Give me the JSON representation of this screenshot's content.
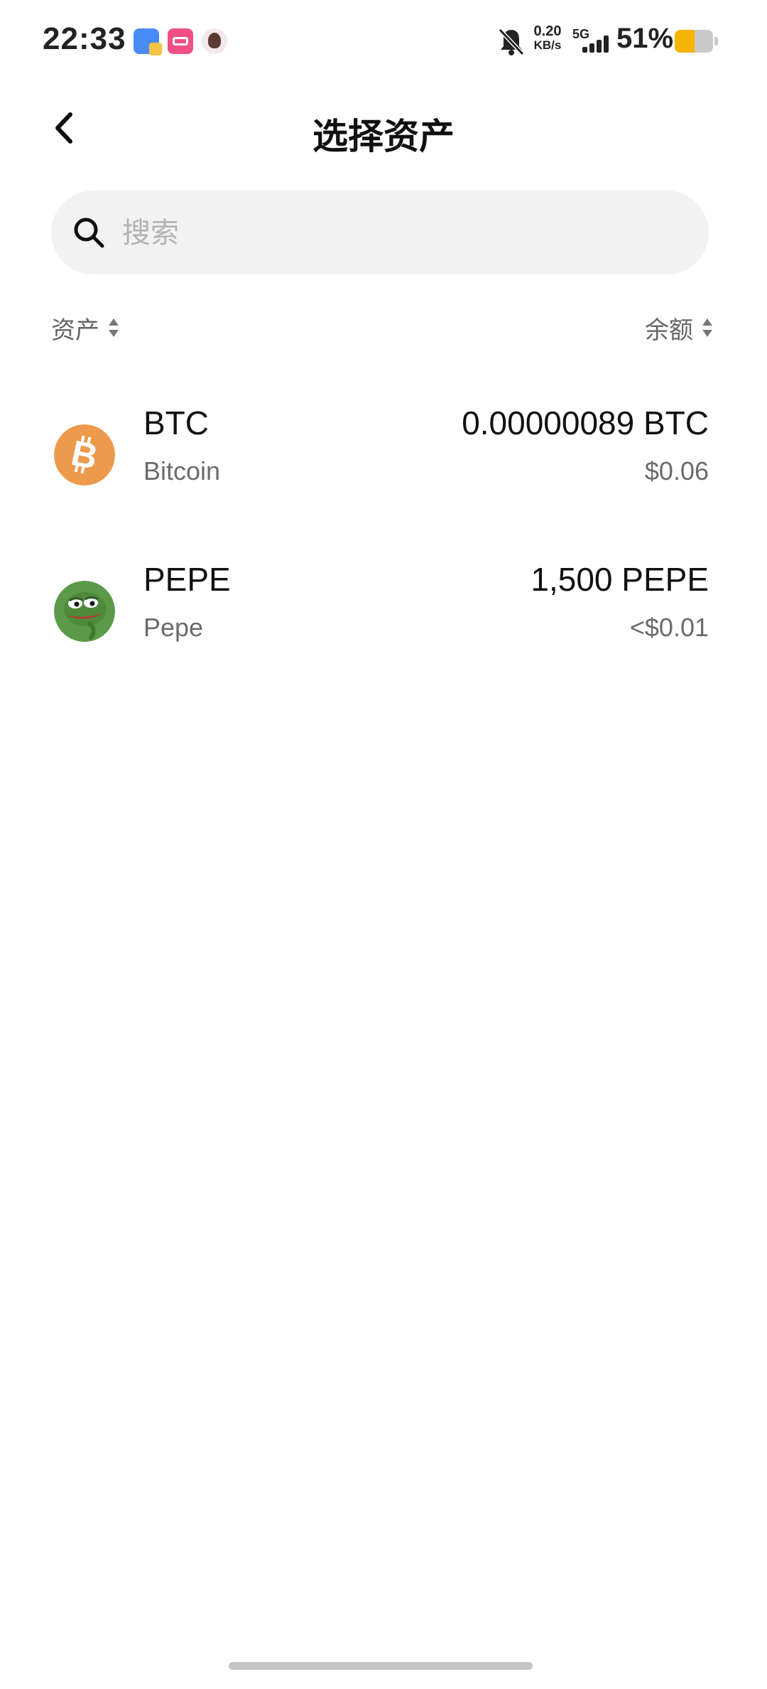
{
  "status_bar": {
    "time": "22:33",
    "net_speed_value": "0.20",
    "net_speed_unit": "KB/s",
    "network_type": "5G",
    "battery_percent": "51%",
    "battery_level": 0.51,
    "battery_color": "#f6b300"
  },
  "header": {
    "title": "选择资产"
  },
  "search": {
    "placeholder": "搜索"
  },
  "columns": {
    "asset_label": "资产",
    "balance_label": "余额"
  },
  "assets": [
    {
      "symbol": "BTC",
      "name": "Bitcoin",
      "balance": "0.00000089 BTC",
      "value": "$0.06",
      "icon": "bitcoin-icon",
      "color": "#ed9a4c"
    },
    {
      "symbol": "PEPE",
      "name": "Pepe",
      "balance": "1,500 PEPE",
      "value": "<$0.01",
      "icon": "pepe-icon",
      "color": "#5a9a48"
    }
  ]
}
